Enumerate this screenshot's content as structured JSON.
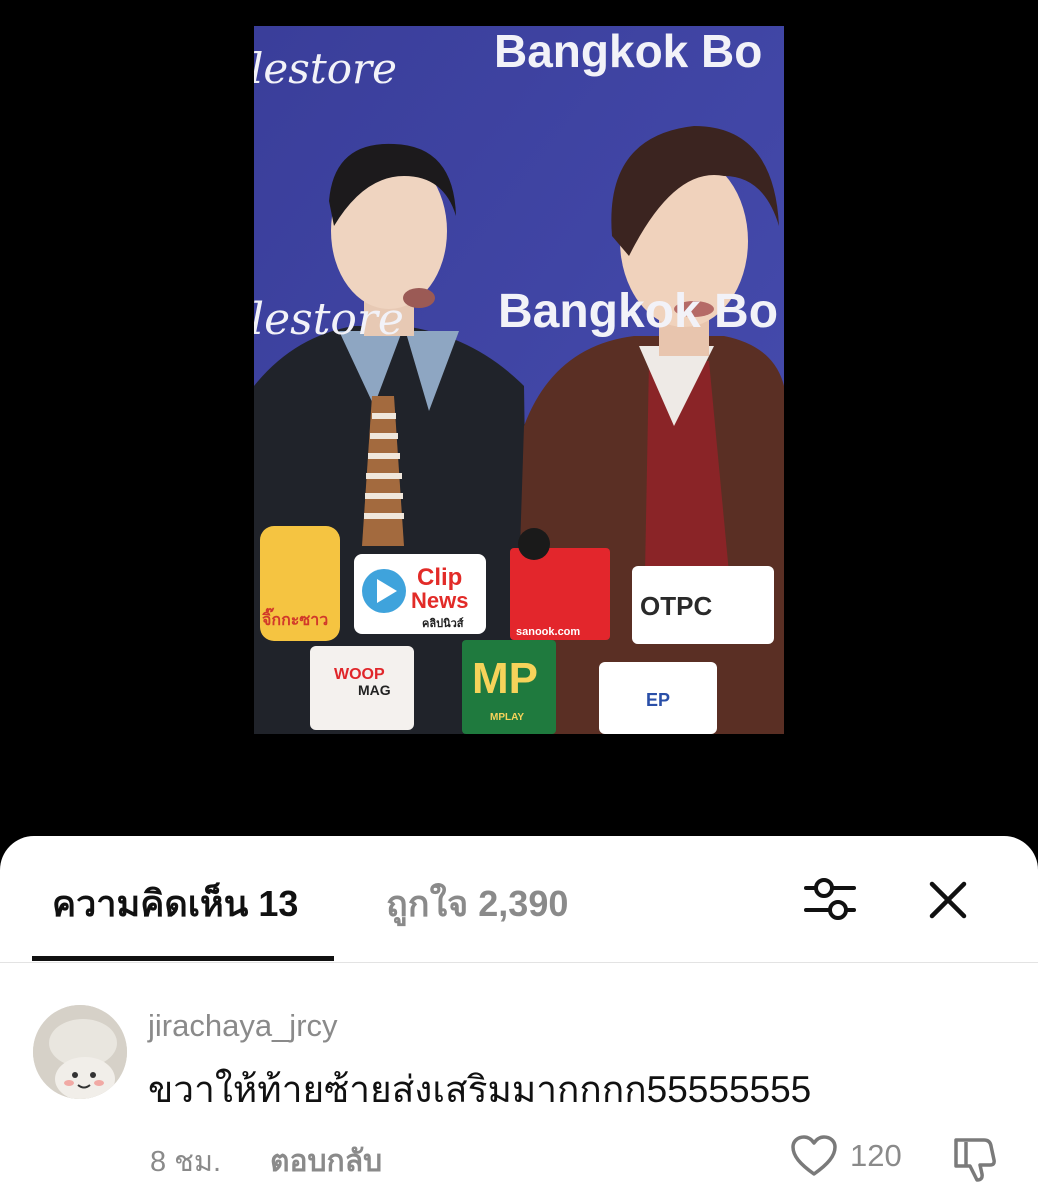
{
  "video": {
    "background_texts": [
      "lestore",
      "Bangkok Bo",
      "lestore",
      "Bangkok Bo"
    ],
    "mic_flags": [
      "Clip",
      "News",
      "คลิปนิวส์",
      "sanook.com",
      "OTPC",
      "WOOP",
      "MAG",
      "MP",
      "MPLAY",
      "จิ๊กกะซาว",
      "EP"
    ]
  },
  "tabs": {
    "comments_label": "ความคิดเห็น",
    "comments_count": "13",
    "likes_label": "ถูกใจ",
    "likes_count": "2,390"
  },
  "comment": {
    "username": "jirachaya_jrcy",
    "text": "ขวาให้ท้ายซ้ายส่งเสริมมากกกก55555555",
    "time": "8 ชม.",
    "reply_label": "ตอบกลับ",
    "like_count": "120"
  },
  "icons": {
    "filter": "sliders-icon",
    "close": "close-icon",
    "like": "heart-outline-icon",
    "dislike": "thumbs-down-icon"
  }
}
